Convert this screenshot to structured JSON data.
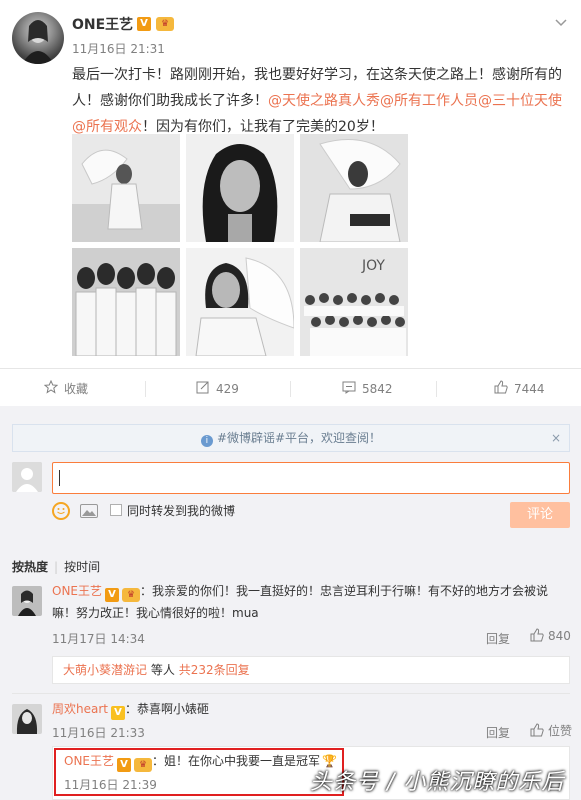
{
  "post": {
    "author": "ONE王艺",
    "verified_badge": "V",
    "crown_badge": "♛",
    "time": "11月16日 21:31",
    "text_plain_1": "最后一次打卡！路刚刚开始，我也要好好学习，在这条天使之路上！感谢所有的人！感谢你们助我成长了许多！",
    "mention_1": "@天使之路真人秀",
    "mention_2": "@所有工作人员",
    "mention_3": "@三十位天使",
    "mention_4": "@所有观众",
    "text_plain_2": "！因为有你们，让我有了完美的20岁！",
    "photos": [
      "beach-wings-photo",
      "portrait-curly-hair-photo",
      "angel-wings-pose-photo",
      "group-five-girls-photo",
      "wings-portrait-photo",
      "group-stage-photo"
    ],
    "joy_sign": "JOY"
  },
  "actions": {
    "favorite": "收藏",
    "repost": "429",
    "comment": "5842",
    "like": "7444"
  },
  "comments_section": {
    "notice": "#微博辟谣#平台，欢迎查阅！",
    "notice_close": "×",
    "repost_checkbox_label": "同时转发到我的微博",
    "submit": "评论",
    "tab_hot": "按热度",
    "tab_time": "按时间",
    "comment_1": {
      "author": "ONE王艺",
      "text": "：我亲爱的你们！我一直挺好的！忠言逆耳利于行嘛！有不好的地方才会被说嘛！努力改正！我心情很好的啦！mua",
      "time": "11月17日 14:34",
      "reply": "回复",
      "likes": "840",
      "replies_user": "大萌小葵潜游记",
      "replies_mid": "等人",
      "replies_count": "共232条回复"
    },
    "comment_2": {
      "author": "周欢heart",
      "text": "：恭喜啊小婊砸",
      "time": "11月16日 21:33",
      "reply": "回复",
      "likes": "位赞"
    },
    "sub_reply": {
      "author": "ONE王艺",
      "text": "：姐！在你心中我要一直是冠军",
      "trophy": "🏆",
      "time": "11月16日 21:39"
    },
    "watermark": "头条号 / 小熊沉瞭的乐后"
  },
  "colors": {
    "link": "#eb7350",
    "badge": "#f29b13",
    "highlight_box": "#e02020",
    "submit_disabled": "#ffc09f"
  }
}
